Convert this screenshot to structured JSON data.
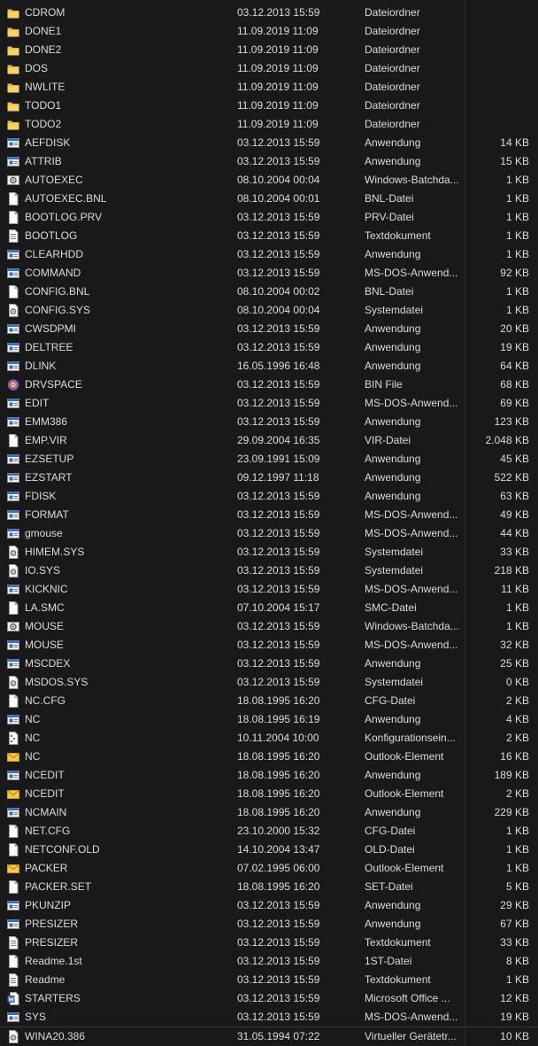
{
  "files": [
    {
      "name": "CDROM",
      "date": "03.12.2013 15:59",
      "type": "Dateiordner",
      "size": "",
      "icon": "folder-icon"
    },
    {
      "name": "DONE1",
      "date": "11.09.2019 11:09",
      "type": "Dateiordner",
      "size": "",
      "icon": "folder-icon"
    },
    {
      "name": "DONE2",
      "date": "11.09.2019 11:09",
      "type": "Dateiordner",
      "size": "",
      "icon": "folder-icon"
    },
    {
      "name": "DOS",
      "date": "11.09.2019 11:09",
      "type": "Dateiordner",
      "size": "",
      "icon": "folder-icon"
    },
    {
      "name": "NWLITE",
      "date": "11.09.2019 11:09",
      "type": "Dateiordner",
      "size": "",
      "icon": "folder-icon"
    },
    {
      "name": "TODO1",
      "date": "11.09.2019 11:09",
      "type": "Dateiordner",
      "size": "",
      "icon": "folder-icon"
    },
    {
      "name": "TODO2",
      "date": "11.09.2019 11:09",
      "type": "Dateiordner",
      "size": "",
      "icon": "folder-icon"
    },
    {
      "name": "AEFDISK",
      "date": "03.12.2013 15:59",
      "type": "Anwendung",
      "size": "14 KB",
      "icon": "application-icon"
    },
    {
      "name": "ATTRIB",
      "date": "03.12.2013 15:59",
      "type": "Anwendung",
      "size": "15 KB",
      "icon": "application-icon"
    },
    {
      "name": "AUTOEXEC",
      "date": "08.10.2004 00:04",
      "type": "Windows-Batchda...",
      "size": "1 KB",
      "icon": "batch-file-icon"
    },
    {
      "name": "AUTOEXEC.BNL",
      "date": "08.10.2004 00:01",
      "type": "BNL-Datei",
      "size": "1 KB",
      "icon": "blank-file-icon"
    },
    {
      "name": "BOOTLOG.PRV",
      "date": "03.12.2013 15:59",
      "type": "PRV-Datei",
      "size": "1 KB",
      "icon": "blank-file-icon"
    },
    {
      "name": "BOOTLOG",
      "date": "03.12.2013 15:59",
      "type": "Textdokument",
      "size": "1 KB",
      "icon": "text-file-icon"
    },
    {
      "name": "CLEARHDD",
      "date": "03.12.2013 15:59",
      "type": "Anwendung",
      "size": "1 KB",
      "icon": "application-icon"
    },
    {
      "name": "COMMAND",
      "date": "03.12.2013 15:59",
      "type": "MS-DOS-Anwend...",
      "size": "92 KB",
      "icon": "application-icon"
    },
    {
      "name": "CONFIG.BNL",
      "date": "08.10.2004 00:02",
      "type": "BNL-Datei",
      "size": "1 KB",
      "icon": "blank-file-icon"
    },
    {
      "name": "CONFIG.SYS",
      "date": "08.10.2004 00:04",
      "type": "Systemdatei",
      "size": "1 KB",
      "icon": "system-file-icon"
    },
    {
      "name": "CWSDPMI",
      "date": "03.12.2013 15:59",
      "type": "Anwendung",
      "size": "20 KB",
      "icon": "application-icon"
    },
    {
      "name": "DELTREE",
      "date": "03.12.2013 15:59",
      "type": "Anwendung",
      "size": "19 KB",
      "icon": "application-icon"
    },
    {
      "name": "DLINK",
      "date": "16.05.1996 16:48",
      "type": "Anwendung",
      "size": "64 KB",
      "icon": "application-icon"
    },
    {
      "name": "DRVSPACE",
      "date": "03.12.2013 15:59",
      "type": "BIN File",
      "size": "68 KB",
      "icon": "disc-file-icon"
    },
    {
      "name": "EDIT",
      "date": "03.12.2013 15:59",
      "type": "MS-DOS-Anwend...",
      "size": "69 KB",
      "icon": "application-icon"
    },
    {
      "name": "EMM386",
      "date": "03.12.2013 15:59",
      "type": "Anwendung",
      "size": "123 KB",
      "icon": "application-icon"
    },
    {
      "name": "EMP.VIR",
      "date": "29.09.2004 16:35",
      "type": "VIR-Datei",
      "size": "2.048 KB",
      "icon": "blank-file-icon"
    },
    {
      "name": "EZSETUP",
      "date": "23.09.1991 15:09",
      "type": "Anwendung",
      "size": "45 KB",
      "icon": "application-icon"
    },
    {
      "name": "EZSTART",
      "date": "09.12.1997 11:18",
      "type": "Anwendung",
      "size": "522 KB",
      "icon": "application-icon"
    },
    {
      "name": "FDISK",
      "date": "03.12.2013 15:59",
      "type": "Anwendung",
      "size": "63 KB",
      "icon": "application-icon"
    },
    {
      "name": "FORMAT",
      "date": "03.12.2013 15:59",
      "type": "MS-DOS-Anwend...",
      "size": "49 KB",
      "icon": "application-icon"
    },
    {
      "name": "gmouse",
      "date": "03.12.2013 15:59",
      "type": "MS-DOS-Anwend...",
      "size": "44 KB",
      "icon": "application-icon"
    },
    {
      "name": "HIMEM.SYS",
      "date": "03.12.2013 15:59",
      "type": "Systemdatei",
      "size": "33 KB",
      "icon": "system-file-icon"
    },
    {
      "name": "IO.SYS",
      "date": "03.12.2013 15:59",
      "type": "Systemdatei",
      "size": "218 KB",
      "icon": "system-file-icon"
    },
    {
      "name": "KICKNIC",
      "date": "03.12.2013 15:59",
      "type": "MS-DOS-Anwend...",
      "size": "11 KB",
      "icon": "application-icon"
    },
    {
      "name": "LA.SMC",
      "date": "07.10.2004 15:17",
      "type": "SMC-Datei",
      "size": "1 KB",
      "icon": "blank-file-icon"
    },
    {
      "name": "MOUSE",
      "date": "03.12.2013 15:59",
      "type": "Windows-Batchda...",
      "size": "1 KB",
      "icon": "batch-file-icon"
    },
    {
      "name": "MOUSE",
      "date": "03.12.2013 15:59",
      "type": "MS-DOS-Anwend...",
      "size": "32 KB",
      "icon": "application-icon"
    },
    {
      "name": "MSCDEX",
      "date": "03.12.2013 15:59",
      "type": "Anwendung",
      "size": "25 KB",
      "icon": "application-icon"
    },
    {
      "name": "MSDOS.SYS",
      "date": "03.12.2013 15:59",
      "type": "Systemdatei",
      "size": "0 KB",
      "icon": "system-file-icon"
    },
    {
      "name": "NC.CFG",
      "date": "18.08.1995 16:20",
      "type": "CFG-Datei",
      "size": "2 KB",
      "icon": "blank-file-icon"
    },
    {
      "name": "NC",
      "date": "18.08.1995 16:19",
      "type": "Anwendung",
      "size": "4 KB",
      "icon": "application-icon"
    },
    {
      "name": "NC",
      "date": "10.11.2004 10:00",
      "type": "Konfigurationsein...",
      "size": "2 KB",
      "icon": "config-file-icon"
    },
    {
      "name": "NC",
      "date": "18.08.1995 16:20",
      "type": "Outlook-Element",
      "size": "16 KB",
      "icon": "mail-icon"
    },
    {
      "name": "NCEDIT",
      "date": "18.08.1995 16:20",
      "type": "Anwendung",
      "size": "189 KB",
      "icon": "application-icon"
    },
    {
      "name": "NCEDIT",
      "date": "18.08.1995 16:20",
      "type": "Outlook-Element",
      "size": "2 KB",
      "icon": "mail-icon"
    },
    {
      "name": "NCMAIN",
      "date": "18.08.1995 16:20",
      "type": "Anwendung",
      "size": "229 KB",
      "icon": "application-icon"
    },
    {
      "name": "NET.CFG",
      "date": "23.10.2000 15:32",
      "type": "CFG-Datei",
      "size": "1 KB",
      "icon": "blank-file-icon"
    },
    {
      "name": "NETCONF.OLD",
      "date": "14.10.2004 13:47",
      "type": "OLD-Datei",
      "size": "1 KB",
      "icon": "blank-file-icon"
    },
    {
      "name": "PACKER",
      "date": "07.02.1995 06:00",
      "type": "Outlook-Element",
      "size": "1 KB",
      "icon": "mail-icon"
    },
    {
      "name": "PACKER.SET",
      "date": "18.08.1995 16:20",
      "type": "SET-Datei",
      "size": "5 KB",
      "icon": "blank-file-icon"
    },
    {
      "name": "PKUNZIP",
      "date": "03.12.2013 15:59",
      "type": "Anwendung",
      "size": "29 KB",
      "icon": "application-icon"
    },
    {
      "name": "PRESIZER",
      "date": "03.12.2013 15:59",
      "type": "Anwendung",
      "size": "67 KB",
      "icon": "application-icon"
    },
    {
      "name": "PRESIZER",
      "date": "03.12.2013 15:59",
      "type": "Textdokument",
      "size": "33 KB",
      "icon": "text-file-icon"
    },
    {
      "name": "Readme.1st",
      "date": "03.12.2013 15:59",
      "type": "1ST-Datei",
      "size": "8 KB",
      "icon": "blank-file-icon"
    },
    {
      "name": "Readme",
      "date": "03.12.2013 15:59",
      "type": "Textdokument",
      "size": "1 KB",
      "icon": "text-file-icon"
    },
    {
      "name": "STARTERS",
      "date": "03.12.2013 15:59",
      "type": "Microsoft Office ...",
      "size": "12 KB",
      "icon": "word-document-icon"
    },
    {
      "name": "SYS",
      "date": "03.12.2013 15:59",
      "type": "MS-DOS-Anwend...",
      "size": "19 KB",
      "icon": "application-icon"
    },
    {
      "name": "WINA20.386",
      "date": "31.05.1994 07:22",
      "type": "Virtueller Gerätetr...",
      "size": "10 KB",
      "icon": "system-file-icon"
    }
  ]
}
